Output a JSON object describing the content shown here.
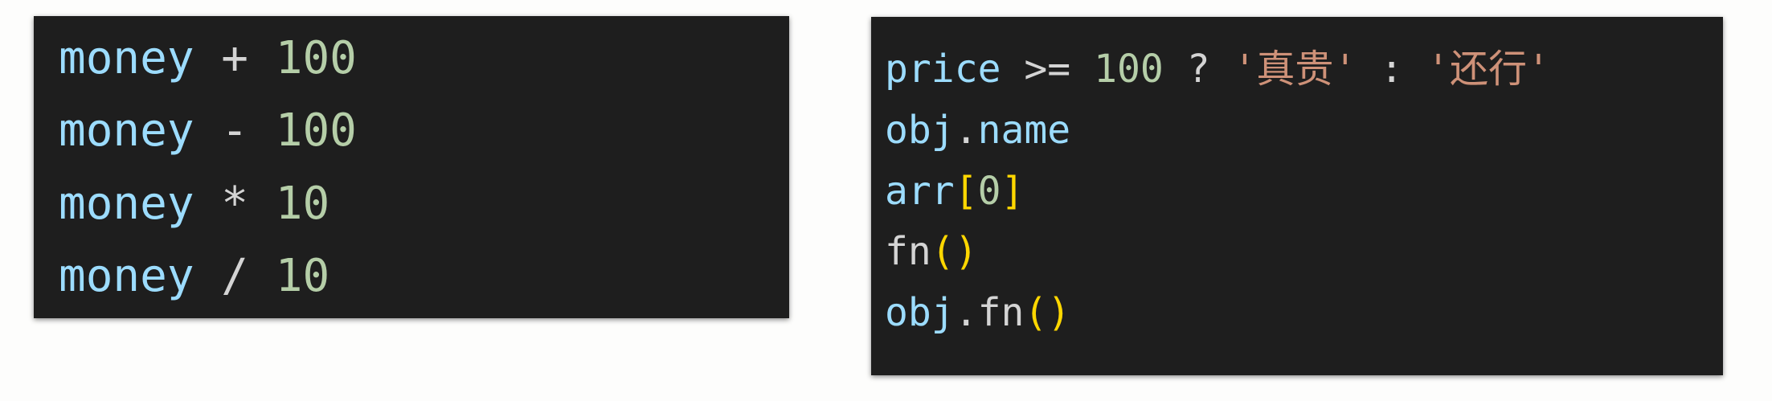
{
  "arithmetic": [
    {
      "var": "money",
      "op": "+",
      "num": "100"
    },
    {
      "var": "money",
      "op": "-",
      "num": "100"
    },
    {
      "var": "money",
      "op": "*",
      "num": "10"
    },
    {
      "var": "money",
      "op": "/",
      "num": "10"
    }
  ],
  "other": {
    "ternary": {
      "var": "price",
      "op1": ">=",
      "num": "100",
      "q": "?",
      "str1": "'真贵'",
      "colon": ":",
      "str2": "'还行'"
    },
    "member": {
      "obj": "obj",
      "dot": ".",
      "prop": "name"
    },
    "index": {
      "arr": "arr",
      "open": "[",
      "num": "0",
      "close": "]"
    },
    "call": {
      "fn": "fn",
      "parens": "()"
    },
    "method_call": {
      "obj": "obj",
      "dot": ".",
      "fn": "fn",
      "parens": "()"
    }
  },
  "colors": {
    "panel_bg": "#1e1e1e",
    "variable": "#9cdcfe",
    "number": "#b5cea8",
    "operator": "#d4d4d4",
    "string": "#ce9178",
    "bracket": "#ffd700"
  }
}
